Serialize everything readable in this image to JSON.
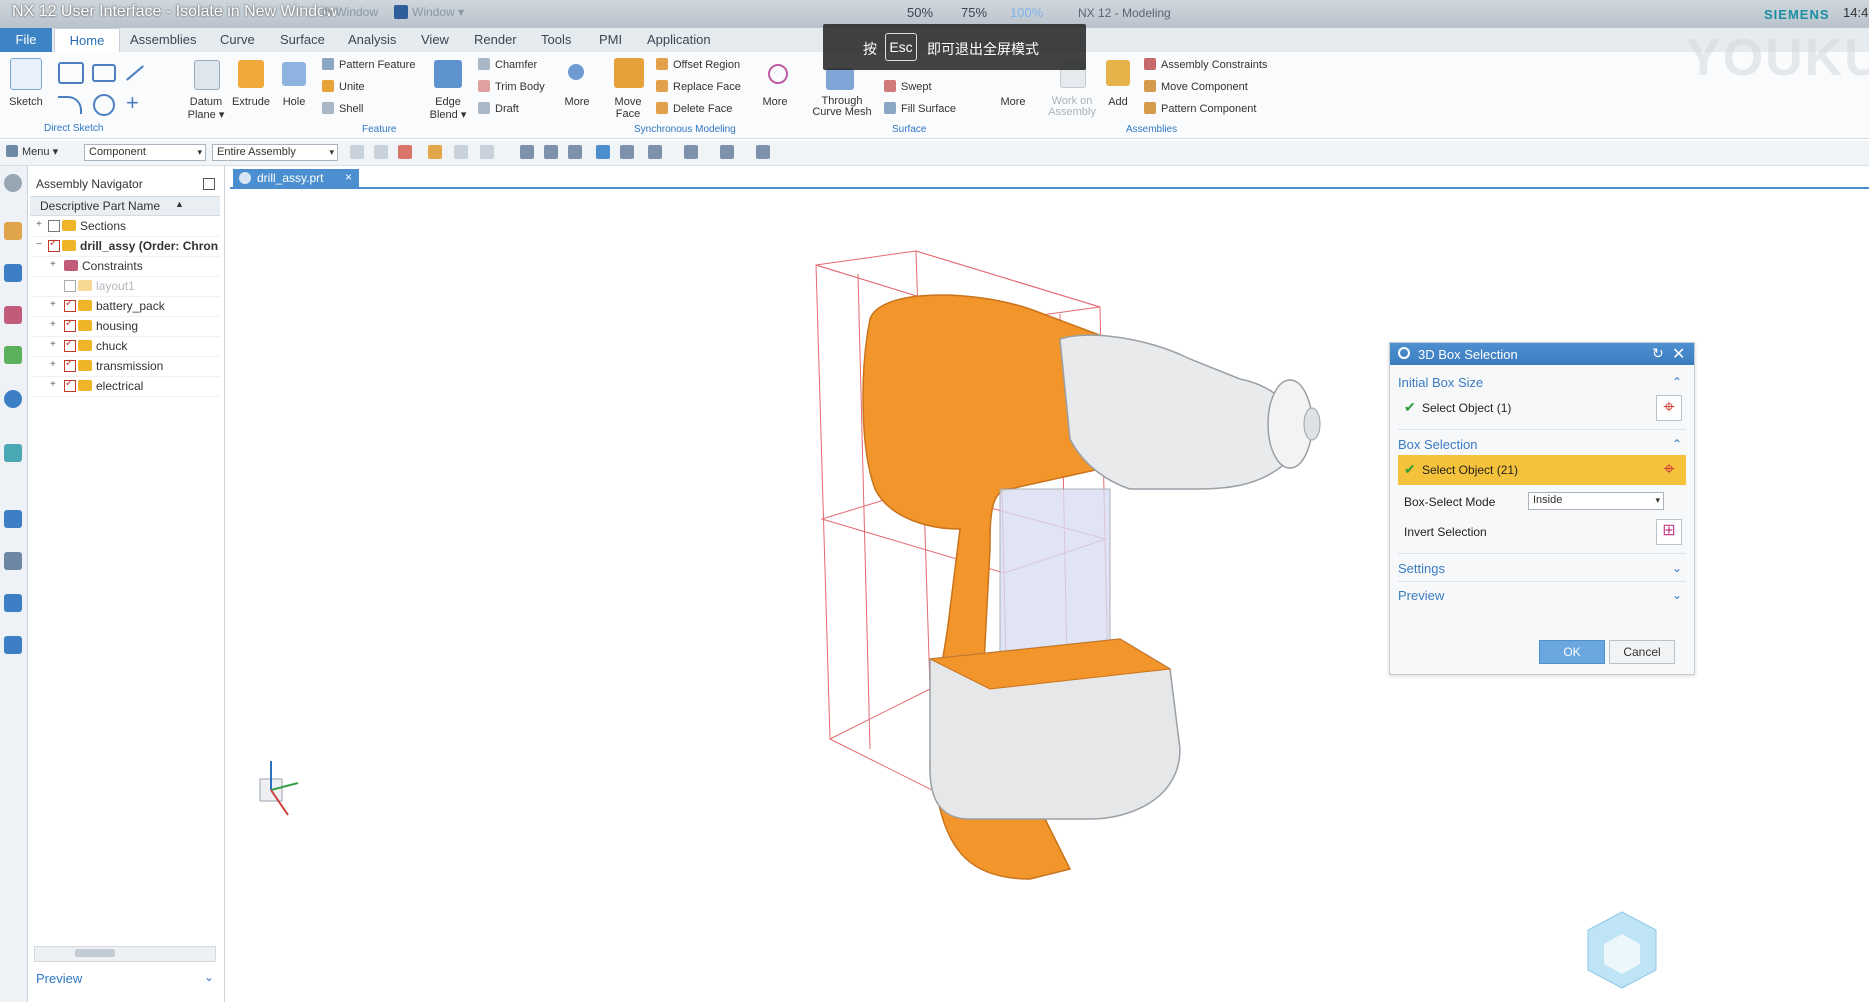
{
  "window": {
    "title": "NX 12 User Interface - Isolate in New Window",
    "title_ghost": "th Window",
    "window_menu": "Window ▾",
    "zoom_levels": [
      "50%",
      "75%",
      "100%"
    ],
    "app_name": "NX 12 - Modeling",
    "brand": "SIEMENS",
    "clock": "14:4",
    "watermark": "YOUKU"
  },
  "toast": {
    "prefix": "按",
    "key": "Esc",
    "suffix": "即可退出全屏模式"
  },
  "tabs": [
    "File",
    "Home",
    "Assemblies",
    "Curve",
    "Surface",
    "Analysis",
    "View",
    "Render",
    "Tools",
    "PMI",
    "Application"
  ],
  "ribbon": {
    "sketch": "Sketch",
    "direct_sketch_group": "Direct Sketch",
    "datum_plane": "Datum Plane ▾",
    "extrude": "Extrude",
    "hole": "Hole",
    "pattern_feature": "Pattern Feature",
    "unite": "Unite",
    "shell": "Shell",
    "edge_blend": "Edge Blend ▾",
    "chamfer": "Chamfer",
    "trim_body": "Trim Body",
    "draft": "Draft",
    "more1": "More",
    "feature_group": "Feature",
    "move_face": "Move Face",
    "offset_region": "Offset Region",
    "replace_face": "Replace Face",
    "delete_face": "Delete Face",
    "more2": "More",
    "sync_group": "Synchronous Modeling",
    "through_curve_mesh": "Through Curve Mesh",
    "swept": "Swept",
    "fill_surface": "Fill Surface",
    "more3": "More",
    "surface_group": "Surface",
    "work_on_assembly": "Work on Assembly",
    "add": "Add",
    "assembly_constraints": "Assembly Constraints",
    "move_component": "Move Component",
    "pattern_component": "Pattern Component",
    "assemblies_group": "Assemblies"
  },
  "toolbar": {
    "menu": "Menu ▾",
    "filter": "Component",
    "scope": "Entire Assembly"
  },
  "navigator": {
    "title": "Assembly Navigator",
    "column": "Descriptive Part Name",
    "rows": [
      {
        "label": "Sections"
      },
      {
        "label": "drill_assy (Order: Chrono"
      },
      {
        "label": "Constraints"
      },
      {
        "label": "layout1"
      },
      {
        "label": "battery_pack"
      },
      {
        "label": "housing"
      },
      {
        "label": "chuck"
      },
      {
        "label": "transmission"
      },
      {
        "label": "electrical"
      }
    ],
    "preview": "Preview"
  },
  "file_tab": "drill_assy.prt",
  "dialog": {
    "title": "3D Box Selection",
    "initial_box_size": "Initial Box Size",
    "select_object_1": "Select Object (1)",
    "box_selection": "Box Selection",
    "select_object_2": "Select Object (21)",
    "box_select_mode_label": "Box-Select Mode",
    "box_select_mode_value": "Inside",
    "invert_selection": "Invert Selection",
    "settings": "Settings",
    "preview": "Preview",
    "ok": "OK",
    "cancel": "Cancel"
  },
  "colors": {
    "accent": "#3b7dc0",
    "highlight": "#f5c33b",
    "model": "#f2952b"
  }
}
